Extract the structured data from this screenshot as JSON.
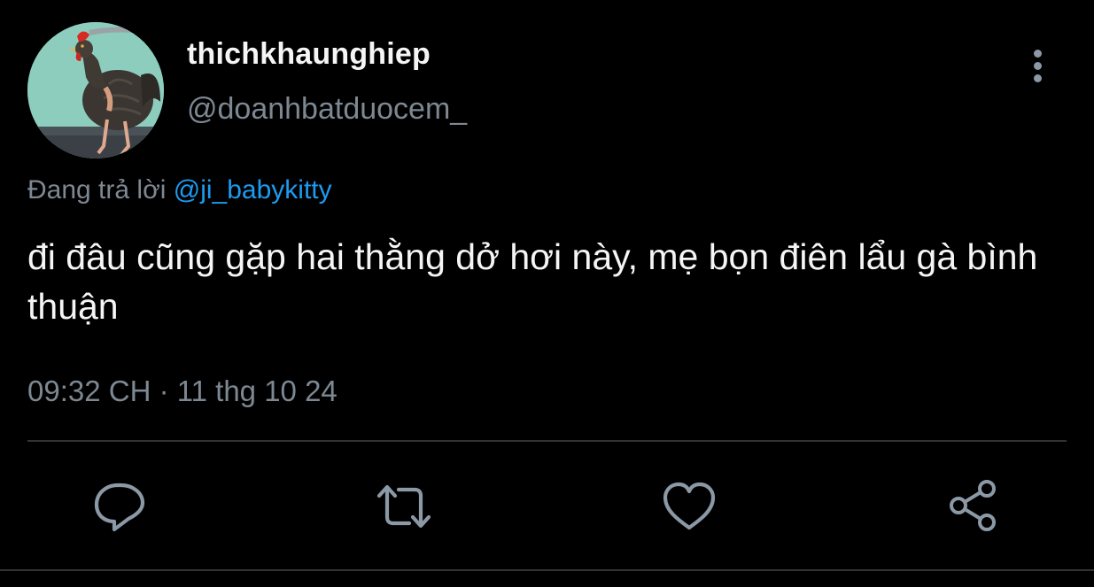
{
  "user": {
    "display_name": "thichkhaunghiep",
    "handle": "@doanhbatduocem_",
    "avatar": "rooster-avatar"
  },
  "reply": {
    "prefix": "Đang trả lời",
    "mention": "@ji_babykitty"
  },
  "tweet": {
    "text": "đi đâu cũng gặp hai thằng dở hơi này, mẹ bọn điên lẩu gà bình thuận",
    "time": "09:32 CH · 11 thg 10 24"
  },
  "actions": {
    "reply": "reply-icon",
    "retweet": "retweet-icon",
    "like": "heart-icon",
    "share": "share-icon"
  },
  "colors": {
    "background": "#000000",
    "text_primary": "#f5f5f5",
    "text_secondary": "#7d8892",
    "link": "#1d9bf0",
    "divider": "#2f3336",
    "icon": "#8b98a5"
  }
}
